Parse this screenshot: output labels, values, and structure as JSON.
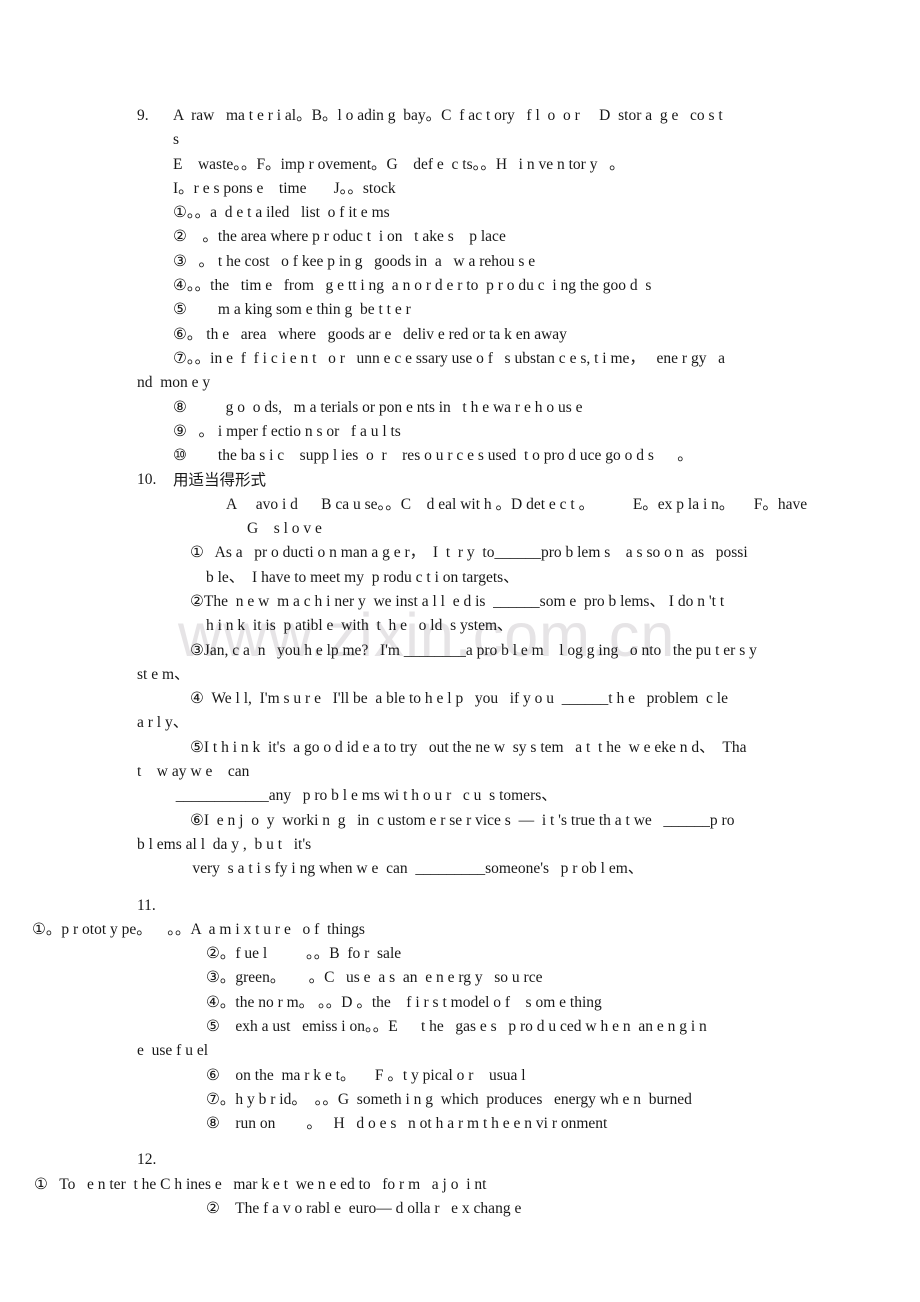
{
  "page": {
    "watermark": "www.zixin.com.cn",
    "watermark_color": "#e6e4e6",
    "background_color": "#ffffff",
    "text_color": "#181818"
  },
  "items": [
    {
      "number": "9.",
      "lines": [
        "A  raw   ma t e r i al。B。l o adin g  bay。C  f ac t ory   f l  o  o r     D  stor a  g e   co s t",
        "s",
        "E    waste。。F。imp r ovement。G    def e  c ts。。H   i n ve n tor y   。",
        "I。r e s pons e    time       J。。stock",
        "①。。a  d e t a iled   list  o f it e ms",
        "②    。the area where p r oduc t  i on   t ake s    p lace",
        "③   。 t he cost   o f kee p in g   goods in  a   w a rehou s e",
        "④。。the   tim e   from   g e tt i ng  a n o r d e r to  p r o du c  i ng the goo d  s",
        "⑤        m a king som e thin g  be t t e r",
        "⑥。 th e   area   where   goods ar e   deliv e red or ta k en away",
        "⑦。。in e  f  f i c i e n t   o r   unn e c e ssary use o f   s ubstan c e s, t i me，   ene r gy   a",
        "nd  mon e y",
        "⑧          g o  o ds,   m a terials or pon e nts in   t h e wa r e h o us e",
        "⑨   。 i mper f ectio n s or   f a u l ts",
        "⑩        the ba s i c    supp l ies  o  r    res o u r c e s used  t o pro d uce go o d s      。"
      ]
    },
    {
      "number": "10.",
      "title": "用适当得形式",
      "lines": [
        "A     avo i d      B ca u se。。C    d eal wit h 。D det e c t 。          E。ex p la i n。     F。have",
        "G    s l o v e",
        "①   As a   pr o ducti o n man a g e r，  I  t  r y  to______pro b lem s    a s so o n  as   possi",
        "b le、  I have to meet my  p rodu c t i on targets、",
        "②The  n e w  m a c h i ner y  we inst a l l  e d is  ______som e  pro b lems、 I do n 't t",
        "h i n k  it is  p atibl e  with  t  h e   o ld  s ystem、",
        "③Jan, c a  n   you h e lp me?   I'm ________a pro b l e m    l og g ing   o nto   the pu t er s y",
        "st e m、",
        "④  We l l,  I'm s u r e   I'll be  a ble to h e l p   you   if y o u  ______t h e   problem  c le",
        "a r l y、",
        "⑤I t h i n k  it's  a go o d id e a to try   out the ne w  sy s tem   a t  t he  w e eke n d、  Tha",
        "t    w ay w e    can",
        "          ____________any   p ro b l e ms wi t h o u r   c u  s tomers、",
        "⑥I  e n j  o  y  worki n  g   in  c ustom e r se r vice s  —  i t 's true th a t we   ______p ro",
        "b l ems al l  da y ,  b u t   it's",
        "     very  s a t i s fy i ng when w e  can  _________someone's   p r ob l em、"
      ]
    },
    {
      "number": "11.",
      "lines": [
        "①。p r otot y pe。    。。A  a m i x t u r e   o f  things",
        "②。f ue l          。。B  fo r  sale",
        "③。green。      。C   us e  a s  an  e n e rg y   so u rce",
        "④。the no r m。 。。D 。the    f i r s t model o f    s om e thing",
        "⑤    exh a ust   emiss i on。。E      t he   gas e s   p ro d u ced w h e n  an e n g i n",
        "e  use f u el",
        "⑥    on the  ma r k e t。     F 。t y pical o r    usua l",
        "⑦。h y b r id。  。。G  someth i n g  which  produces   energy wh e n  burned",
        "⑧    run on        。   H   d o e s   n ot h a r m t h e e n vi r onment"
      ]
    },
    {
      "number": "12.",
      "lines": [
        "①   To   e n ter  t he C h ines e   mar k e t  we n e ed to   fo r m   a j o  i nt",
        "②    The f a v o rabl e  euro— d olla r   e x chang e"
      ]
    }
  ]
}
